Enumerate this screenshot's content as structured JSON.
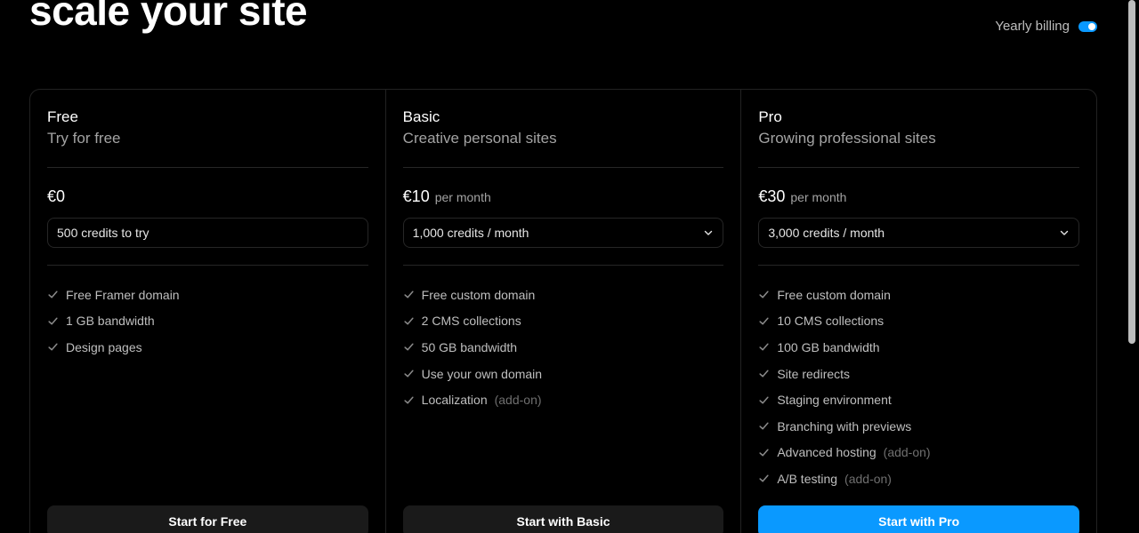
{
  "headline": "scale your site",
  "billing": {
    "label": "Yearly billing",
    "enabled": true
  },
  "colors": {
    "accent": "#0a99ff",
    "background": "#000000"
  },
  "plans": [
    {
      "name": "Free",
      "subtitle": "Try for free",
      "price": "€0",
      "period": "",
      "credits": "500 credits to try",
      "has_dropdown": false,
      "features": [
        {
          "text": "Free Framer domain",
          "addon": ""
        },
        {
          "text": "1 GB bandwidth",
          "addon": ""
        },
        {
          "text": "Design pages",
          "addon": ""
        }
      ],
      "cta": "Start for Free"
    },
    {
      "name": "Basic",
      "subtitle": "Creative personal sites",
      "price": "€10",
      "period": "per month",
      "credits": "1,000 credits / month",
      "has_dropdown": true,
      "features": [
        {
          "text": "Free custom domain",
          "addon": ""
        },
        {
          "text": "2 CMS collections",
          "addon": ""
        },
        {
          "text": "50 GB bandwidth",
          "addon": ""
        },
        {
          "text": "Use your own domain",
          "addon": ""
        },
        {
          "text": "Localization",
          "addon": "(add-on)"
        }
      ],
      "cta": "Start with Basic"
    },
    {
      "name": "Pro",
      "subtitle": "Growing professional sites",
      "price": "€30",
      "period": "per month",
      "credits": "3,000 credits / month",
      "has_dropdown": true,
      "features": [
        {
          "text": "Free custom domain",
          "addon": ""
        },
        {
          "text": "10 CMS collections",
          "addon": ""
        },
        {
          "text": "100 GB bandwidth",
          "addon": ""
        },
        {
          "text": "Site redirects",
          "addon": ""
        },
        {
          "text": "Staging environment",
          "addon": ""
        },
        {
          "text": "Branching with previews",
          "addon": ""
        },
        {
          "text": "Advanced hosting",
          "addon": "(add-on)"
        },
        {
          "text": "A/B testing",
          "addon": "(add-on)"
        }
      ],
      "cta": "Start with Pro"
    }
  ]
}
